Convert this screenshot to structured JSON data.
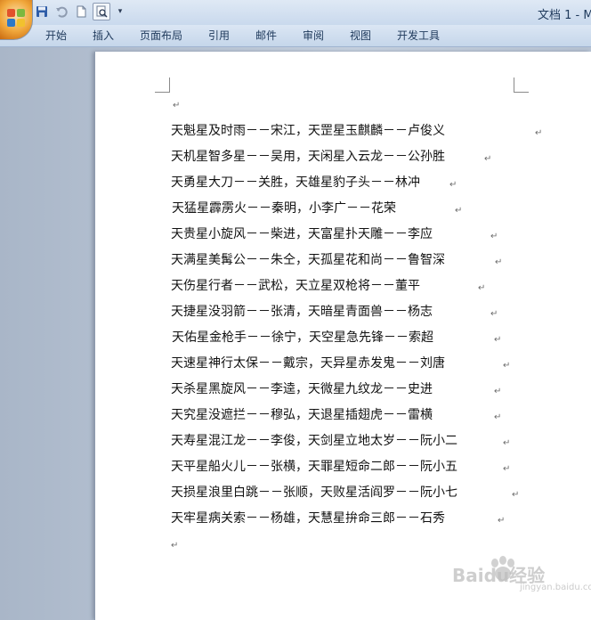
{
  "window": {
    "title": "文档 1 - M"
  },
  "quick_access": {
    "icons": [
      "save-icon",
      "undo-icon",
      "new-document-icon",
      "print-preview-icon",
      "customize-arrow-icon"
    ]
  },
  "ribbon": {
    "tabs": [
      {
        "label": "开始"
      },
      {
        "label": "插入"
      },
      {
        "label": "页面布局"
      },
      {
        "label": "引用"
      },
      {
        "label": "邮件"
      },
      {
        "label": "审阅"
      },
      {
        "label": "视图"
      },
      {
        "label": "开发工具"
      }
    ]
  },
  "document": {
    "paragraph_mark": "↵",
    "lines": [
      "天魁星及时雨－－宋江，天罡星玉麒麟－－卢俊义",
      "天机星智多星－－吴用，天闲星入云龙－－公孙胜",
      "天勇星大刀－－关胜，天雄星豹子头－－林冲",
      "天猛星霹雳火－－秦明，小李广－－花荣",
      "天贵星小旋风－－柴进，天富星扑天雕－－李应",
      "天满星美髯公－－朱仝，天孤星花和尚－－鲁智深",
      "天伤星行者－－武松，天立星双枪将－－董平",
      "天捷星没羽箭－－张清，天暗星青面兽－－杨志",
      "天佑星金枪手－－徐宁，天空星急先锋－－索超",
      "天速星神行太保－－戴宗，天异星赤发鬼－－刘唐",
      "天杀星黑旋风－－李逵，天微星九纹龙－－史进",
      "天究星没遮拦－－穆弘，天退星插翅虎－－雷横",
      "天寿星混江龙－－李俊，天剑星立地太岁－－阮小二",
      "天平星船火儿－－张横，天罪星短命二郎－－阮小五",
      "天损星浪里白跳－－张顺，天败星活阎罗－－阮小七",
      "天牢星病关索－－杨雄，天慧星拚命三郎－－石秀"
    ]
  },
  "watermark": {
    "text": "Baidu经验",
    "sub": "jingyan.baidu.com"
  },
  "colors": {
    "ribbon_text": "#1e395b",
    "page": "#ffffff",
    "workspace": "#b8c4d4"
  }
}
